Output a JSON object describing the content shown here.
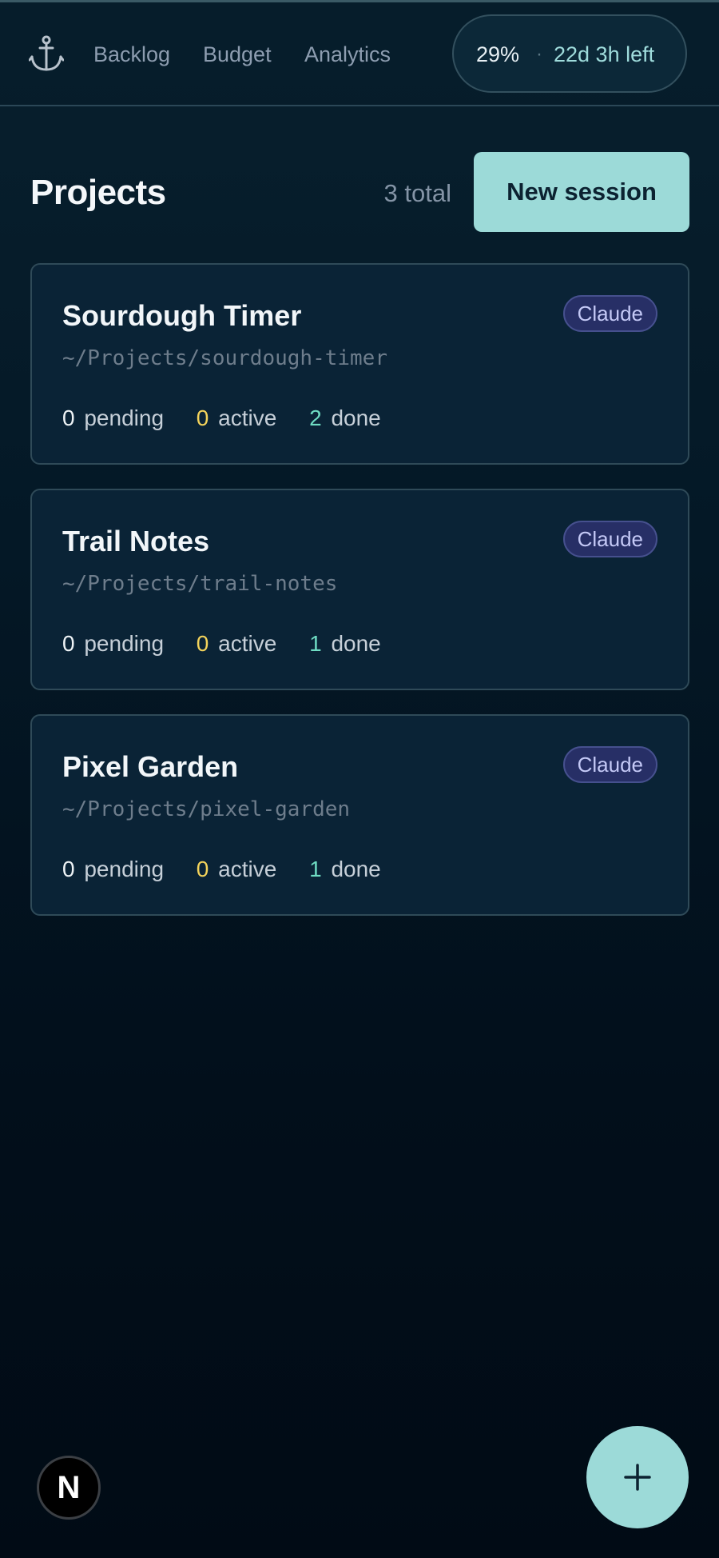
{
  "header": {
    "logo_icon": "anchor-icon",
    "nav": [
      "Backlog",
      "Budget",
      "Analytics"
    ],
    "usage": {
      "percent": "29%",
      "separator": "·",
      "time_left": "22d 3h left"
    }
  },
  "main": {
    "title": "Projects",
    "total": "3 total",
    "new_session_label": "New session",
    "projects": [
      {
        "name": "Sourdough Timer",
        "path": "~/Projects/sourdough-timer",
        "agent": "Claude",
        "pending": "0",
        "active": "0",
        "done": "2"
      },
      {
        "name": "Trail Notes",
        "path": "~/Projects/trail-notes",
        "agent": "Claude",
        "pending": "0",
        "active": "0",
        "done": "1"
      },
      {
        "name": "Pixel Garden",
        "path": "~/Projects/pixel-garden",
        "agent": "Claude",
        "pending": "0",
        "active": "0",
        "done": "1"
      }
    ],
    "stat_labels": {
      "pending": "pending",
      "active": "active",
      "done": "done"
    }
  },
  "footer": {
    "avatar_letter": "N",
    "fab_icon": "plus-icon"
  },
  "colors": {
    "accent": "#9cdad8",
    "background": "#041826",
    "active": "#f3d35b",
    "done": "#6fdcc3",
    "badge": "#272f66"
  }
}
